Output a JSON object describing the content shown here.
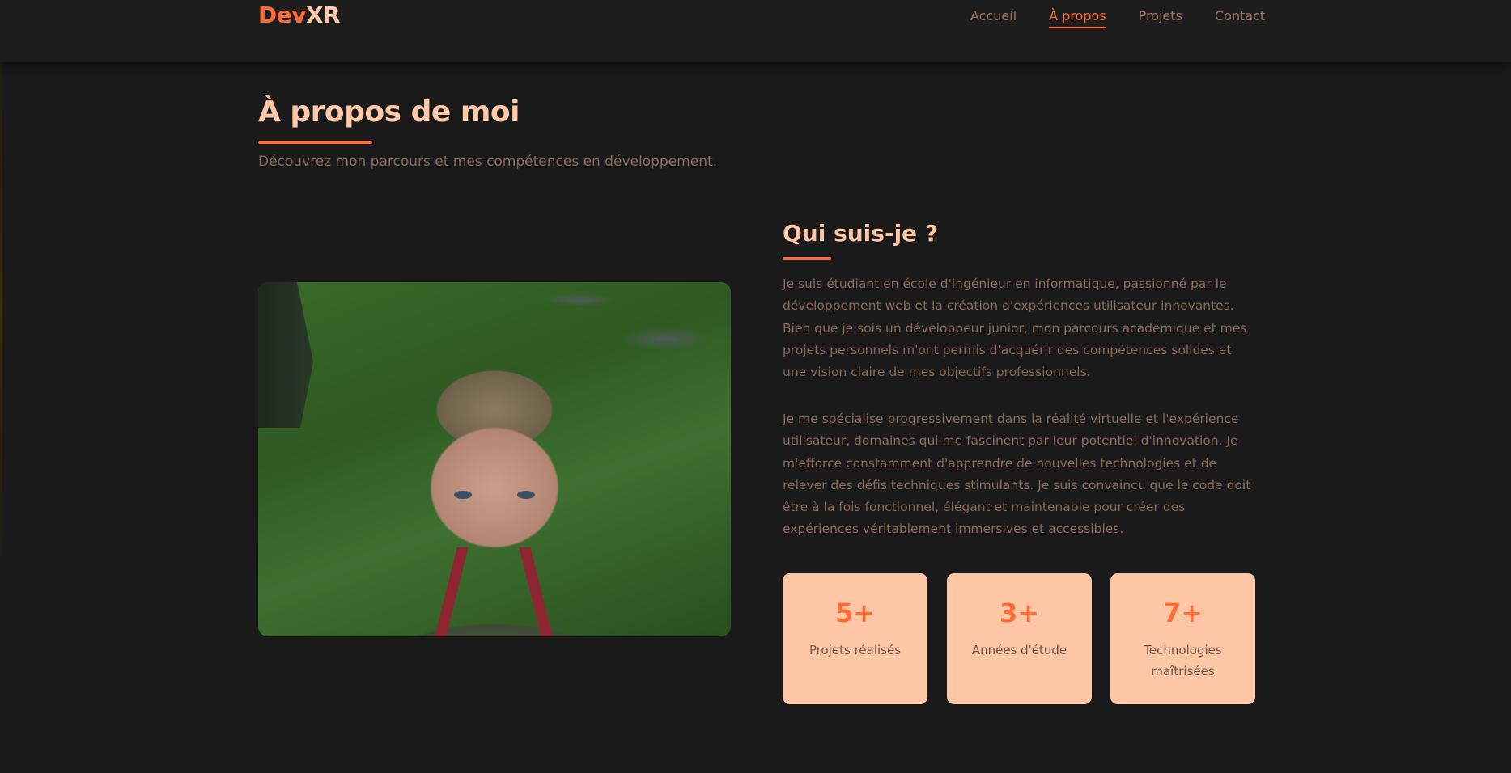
{
  "header": {
    "logo_part1": "Dev",
    "logo_part2": "XR",
    "nav": [
      {
        "label": "Accueil",
        "active": false
      },
      {
        "label": "À propos",
        "active": true
      },
      {
        "label": "Projets",
        "active": false
      },
      {
        "label": "Contact",
        "active": false
      }
    ]
  },
  "about": {
    "title": "À propos de moi",
    "subtitle": "Découvrez mon parcours et mes compétences en développement.",
    "section_title": "Qui suis-je ?",
    "paragraphs": [
      "Je suis étudiant en école d'ingénieur en informatique, passionné par le développement web et la création d'expériences utilisateur innovantes. Bien que je sois un développeur junior, mon parcours académique et mes projets personnels m'ont permis d'acquérir des compétences solides et une vision claire de mes objectifs professionnels.",
      "Je me spécialise progressivement dans la réalité virtuelle et l'expérience utilisateur, domaines qui me fascinent par leur potentiel d'innovation. Je m'efforce constamment d'apprendre de nouvelles technologies et de relever des défis techniques stimulants. Je suis convaincu que le code doit être à la fois fonctionnel, élégant et maintenable pour créer des expériences véritablement immersives et accessibles."
    ],
    "stats": [
      {
        "value": "5+",
        "label": "Projets réalisés"
      },
      {
        "value": "3+",
        "label": "Années d'étude"
      },
      {
        "value": "7+",
        "label": "Technologies maîtrisées"
      }
    ]
  },
  "colors": {
    "accent": "#ff6b35",
    "heading": "#ffc9a8",
    "background": "#1a1a1a",
    "card": "#fdc7a6"
  }
}
